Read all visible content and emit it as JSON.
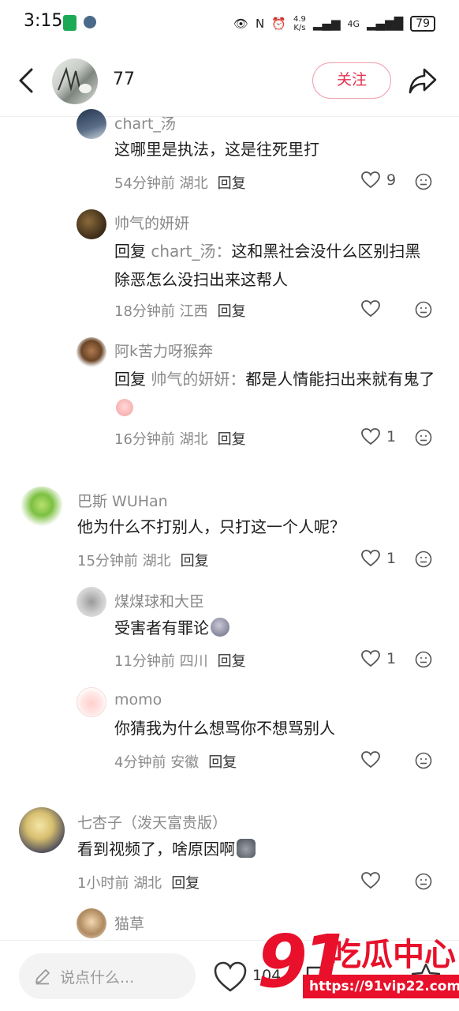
{
  "status_bar": {
    "time": "3:15",
    "net_speed_value": "4.9",
    "net_speed_unit": "K/s",
    "network": "4G",
    "battery": "79"
  },
  "header": {
    "title": "77",
    "follow_label": "关注"
  },
  "comments": [
    {
      "user": "chart_汤",
      "text": "这哪里是执法，这是往死里打",
      "time": "54分钟前",
      "location": "湖北",
      "reply_label": "回复",
      "likes": "9"
    },
    {
      "user": "帅气的妍妍",
      "reply_prefix": "回复",
      "reply_to": "chart_汤：",
      "text": "这和黑社会没什么区别扫黑除恶怎么没扫出来这帮人",
      "time": "18分钟前",
      "location": "江西",
      "reply_label": "回复",
      "likes": ""
    },
    {
      "user": "阿k苦力呀猴奔",
      "reply_prefix": "回复",
      "reply_to": "帅气的妍妍：",
      "text": "都是人情能扫出来就有鬼了",
      "time": "16分钟前",
      "location": "湖北",
      "reply_label": "回复",
      "likes": "1"
    },
    {
      "user": "巴斯 WUHan",
      "text": "他为什么不打别人，只打这一个人呢？",
      "time": "15分钟前",
      "location": "湖北",
      "reply_label": "回复",
      "likes": "1"
    },
    {
      "user": "煤煤球和大臣",
      "text": "受害者有罪论",
      "time": "11分钟前",
      "location": "四川",
      "reply_label": "回复",
      "likes": "1"
    },
    {
      "user": "momo",
      "text": "你猜我为什么想骂你不想骂别人",
      "time": "4分钟前",
      "location": "安徽",
      "reply_label": "回复",
      "likes": ""
    },
    {
      "user": "七杏子（泼天富贵版）",
      "text": "看到视频了，啥原因啊",
      "time": "1小时前",
      "location": "湖北",
      "reply_label": "回复",
      "likes": ""
    },
    {
      "user": "猫草"
    }
  ],
  "bottom_bar": {
    "input_placeholder": "说点什么...",
    "like_count": "104"
  },
  "watermark": {
    "logo": "91",
    "name": "吃瓜中心",
    "url": "https://91vip22.com"
  },
  "colors": {
    "accent": "#e23350",
    "watermark": "#e8102a"
  }
}
